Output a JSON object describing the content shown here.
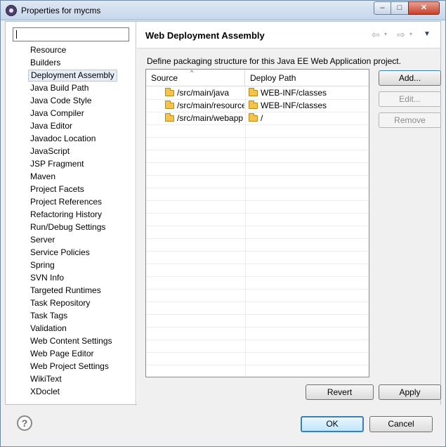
{
  "window": {
    "title": "Properties for mycms",
    "controls": {
      "minimize": "–",
      "maximize": "□",
      "close": "✕"
    }
  },
  "sidebar": {
    "filter_value": "",
    "items": [
      "Resource",
      "Builders",
      "Deployment Assembly",
      "Java Build Path",
      "Java Code Style",
      "Java Compiler",
      "Java Editor",
      "Javadoc Location",
      "JavaScript",
      "JSP Fragment",
      "Maven",
      "Project Facets",
      "Project References",
      "Refactoring History",
      "Run/Debug Settings",
      "Server",
      "Service Policies",
      "Spring",
      "SVN Info",
      "Targeted Runtimes",
      "Task Repository",
      "Task Tags",
      "Validation",
      "Web Content Settings",
      "Web Page Editor",
      "Web Project Settings",
      "WikiText",
      "XDoclet"
    ],
    "selected_index": 2
  },
  "page": {
    "title": "Web Deployment Assembly",
    "description": "Define packaging structure for this Java EE Web Application project.",
    "nav": {
      "back": "⇦",
      "forward": "⇨",
      "dropdown": "▾",
      "menu": "▼"
    }
  },
  "table": {
    "columns": [
      "Source",
      "Deploy Path"
    ],
    "sort_indicator": "^",
    "rows": [
      {
        "source": "/src/main/java",
        "deploy": "WEB-INF/classes"
      },
      {
        "source": "/src/main/resources",
        "deploy": "WEB-INF/classes"
      },
      {
        "source": "/src/main/webapp",
        "deploy": "/"
      }
    ]
  },
  "buttons": {
    "add": "Add...",
    "edit": "Edit...",
    "remove": "Remove",
    "revert": "Revert",
    "apply": "Apply",
    "ok": "OK",
    "cancel": "Cancel",
    "help": "?"
  },
  "colors": {
    "title_bar": "#c6d6ea",
    "close_button": "#c8412a",
    "default_button_border": "#3c7fb1",
    "folder": "#f3c34c"
  }
}
